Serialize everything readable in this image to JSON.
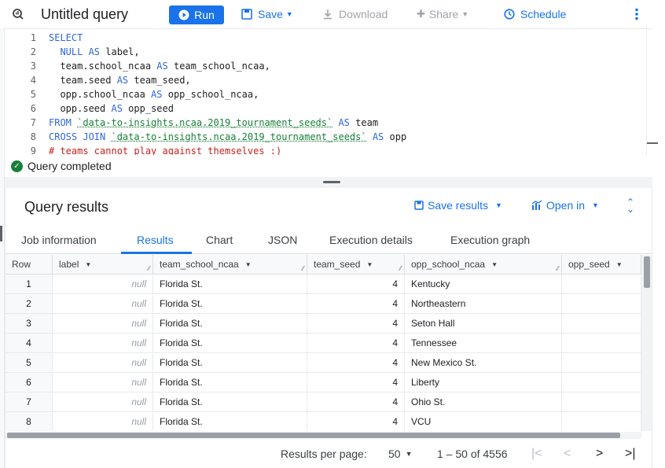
{
  "toolbar": {
    "title": "Untitled query",
    "run": "Run",
    "save": "Save",
    "download": "Download",
    "share": "Share",
    "schedule": "Schedule"
  },
  "editor": {
    "lines": [
      {
        "n": "1",
        "parts": [
          {
            "t": "SELECT",
            "c": "kw"
          }
        ]
      },
      {
        "n": "2",
        "parts": [
          {
            "t": "  NULL ",
            "c": "kw"
          },
          {
            "t": "AS ",
            "c": "kw"
          },
          {
            "t": "label,",
            "c": "id"
          }
        ]
      },
      {
        "n": "3",
        "parts": [
          {
            "t": "  team.school_ncaa ",
            "c": "id"
          },
          {
            "t": "AS ",
            "c": "kw"
          },
          {
            "t": "team_school_ncaa,",
            "c": "id"
          }
        ]
      },
      {
        "n": "4",
        "parts": [
          {
            "t": "  team.seed ",
            "c": "id"
          },
          {
            "t": "AS ",
            "c": "kw"
          },
          {
            "t": "team_seed,",
            "c": "id"
          }
        ]
      },
      {
        "n": "5",
        "parts": [
          {
            "t": "  opp.school_ncaa ",
            "c": "id"
          },
          {
            "t": "AS ",
            "c": "kw"
          },
          {
            "t": "opp_school_ncaa,",
            "c": "id"
          }
        ]
      },
      {
        "n": "6",
        "parts": [
          {
            "t": "  opp.seed ",
            "c": "id"
          },
          {
            "t": "AS ",
            "c": "kw"
          },
          {
            "t": "opp_seed",
            "c": "id"
          }
        ]
      },
      {
        "n": "7",
        "parts": [
          {
            "t": "FROM ",
            "c": "kw"
          },
          {
            "t": "`data-to-insights.ncaa.2019_tournament_seeds`",
            "c": "str"
          },
          {
            "t": " AS ",
            "c": "kw"
          },
          {
            "t": "team",
            "c": "id"
          }
        ]
      },
      {
        "n": "8",
        "parts": [
          {
            "t": "CROSS JOIN ",
            "c": "kw"
          },
          {
            "t": "`data-to-insights.ncaa.2019_tournament_seeds`",
            "c": "str"
          },
          {
            "t": " AS ",
            "c": "kw"
          },
          {
            "t": "opp",
            "c": "id"
          }
        ]
      },
      {
        "n": "9",
        "parts": [
          {
            "t": "# teams cannot play against themselves :)",
            "c": "cmt"
          }
        ]
      }
    ]
  },
  "status": "Query completed",
  "results": {
    "title": "Query results",
    "save_results": "Save results",
    "open_in": "Open in",
    "tabs": [
      "Job information",
      "Results",
      "Chart",
      "JSON",
      "Execution details",
      "Execution graph"
    ],
    "active_tab": "Results",
    "columns": [
      "Row",
      "label",
      "team_school_ncaa",
      "team_seed",
      "opp_school_ncaa",
      "opp_seed"
    ],
    "rows": [
      [
        "1",
        "null",
        "Florida St.",
        "4",
        "Kentucky",
        ""
      ],
      [
        "2",
        "null",
        "Florida St.",
        "4",
        "Northeastern",
        ""
      ],
      [
        "3",
        "null",
        "Florida St.",
        "4",
        "Seton Hall",
        ""
      ],
      [
        "4",
        "null",
        "Florida St.",
        "4",
        "Tennessee",
        ""
      ],
      [
        "5",
        "null",
        "Florida St.",
        "4",
        "New Mexico St.",
        ""
      ],
      [
        "6",
        "null",
        "Florida St.",
        "4",
        "Liberty",
        ""
      ],
      [
        "7",
        "null",
        "Florida St.",
        "4",
        "Ohio St.",
        ""
      ],
      [
        "8",
        "null",
        "Florida St.",
        "4",
        "VCU",
        ""
      ]
    ],
    "pager": {
      "per_page_label": "Results per page:",
      "per_page": "50",
      "range": "1 – 50 of 4556"
    }
  }
}
